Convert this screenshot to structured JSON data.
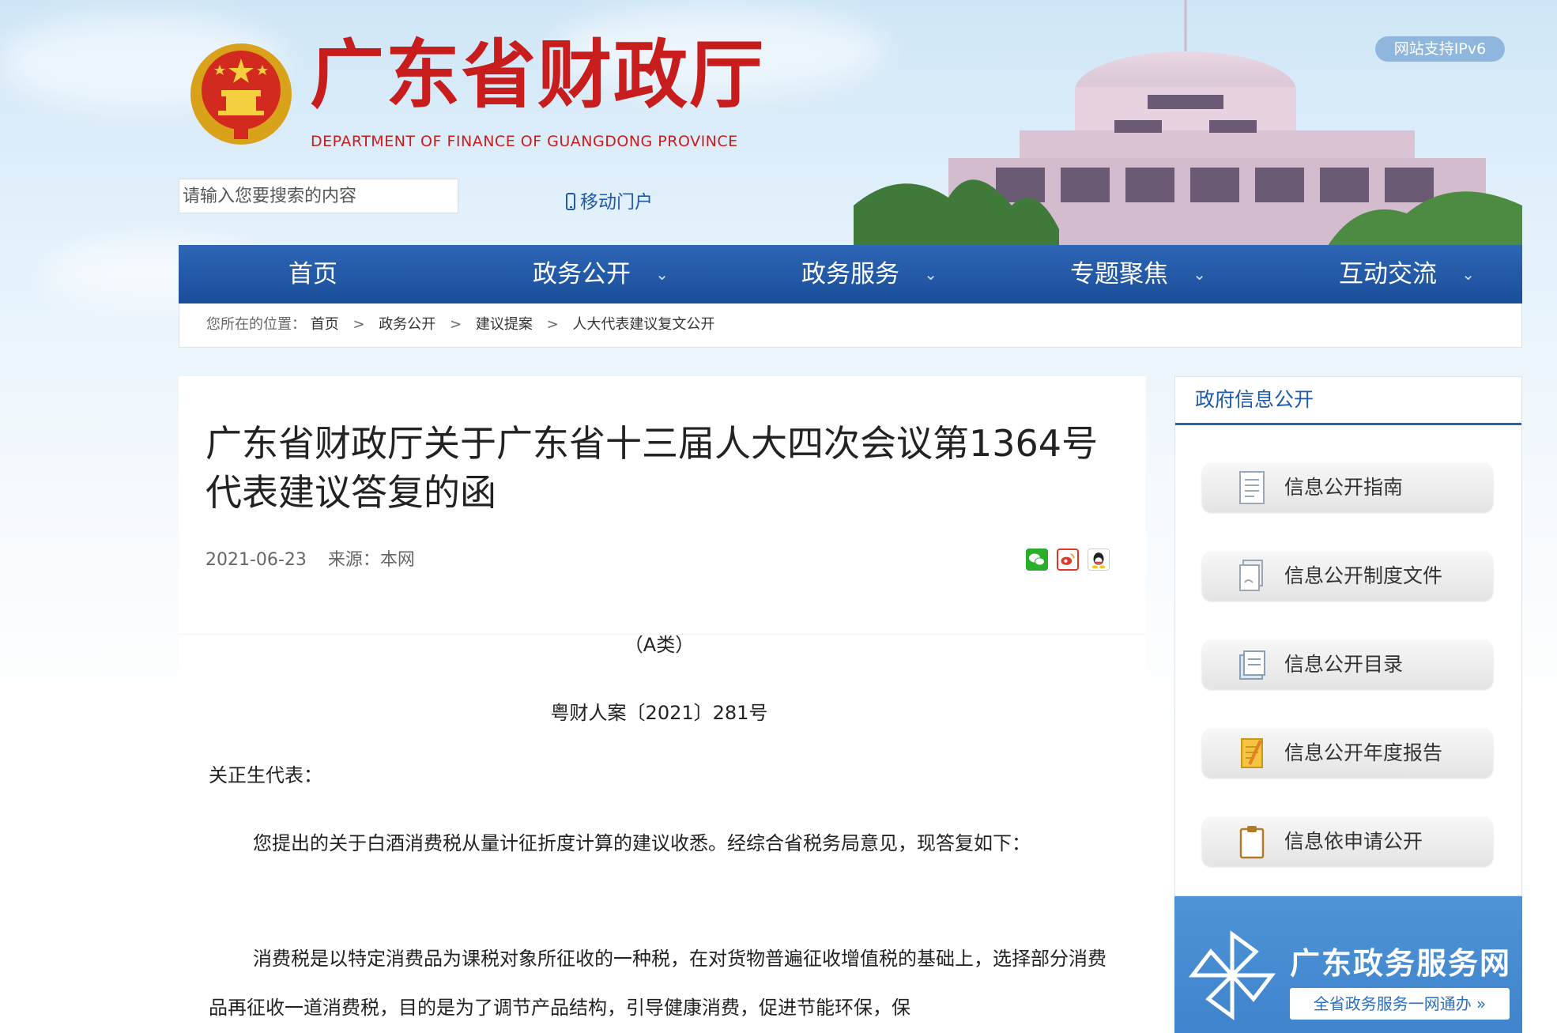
{
  "header": {
    "site_title": "广东省财政厅",
    "site_subtitle": "DEPARTMENT OF FINANCE OF GUANGDONG PROVINCE",
    "ipv6_badge": "网站支持IPv6",
    "search_placeholder": "请输入您要搜索的内容",
    "mobile_portal": "移动门户"
  },
  "nav": {
    "items": [
      {
        "label": "首页",
        "has_dropdown": false
      },
      {
        "label": "政务公开",
        "has_dropdown": true
      },
      {
        "label": "政务服务",
        "has_dropdown": true
      },
      {
        "label": "专题聚焦",
        "has_dropdown": true
      },
      {
        "label": "互动交流",
        "has_dropdown": true
      }
    ],
    "dropdown_glyph": "⌄"
  },
  "breadcrumb": {
    "prefix": "您所在的位置：",
    "items": [
      "首页",
      "政务公开",
      "建议提案",
      "人大代表建议复文公开"
    ],
    "separator": ">"
  },
  "article": {
    "title": "广东省财政厅关于广东省十三届人大四次会议第1364号代表建议答复的函",
    "date": "2021-06-23",
    "source": "来源：本网",
    "share_icons": [
      "wechat-icon",
      "weibo-icon",
      "qq-icon"
    ],
    "category": "（A类）",
    "doc_number": "粤财人案〔2021〕281号",
    "salutation": "关正生代表：",
    "para1": "您提出的关于白酒消费税从量计征折度计算的建议收悉。经综合省税务局意见，现答复如下：",
    "para2": "消费税是以特定消费品为课税对象所征收的一种税，在对货物普遍征收增值税的基础上，选择部分消费品再征收一道消费税，目的是为了调节产品结构，引导健康消费，促进节能环保，保"
  },
  "sidebar": {
    "title": "政府信息公开",
    "buttons": [
      {
        "label": "信息公开指南",
        "icon": "document-icon"
      },
      {
        "label": "信息公开制度文件",
        "icon": "files-icon"
      },
      {
        "label": "信息公开目录",
        "icon": "folder-icon"
      },
      {
        "label": "信息公开年度报告",
        "icon": "report-icon"
      },
      {
        "label": "信息依申请公开",
        "icon": "clipboard-icon"
      }
    ],
    "banner": {
      "title": "广东政务服务网",
      "subtitle": "全省政务服务一网通办 »"
    }
  },
  "colors": {
    "brand_red": "#c81d1d",
    "nav_blue": "#1f56a4",
    "link_blue": "#1e5aa8"
  }
}
